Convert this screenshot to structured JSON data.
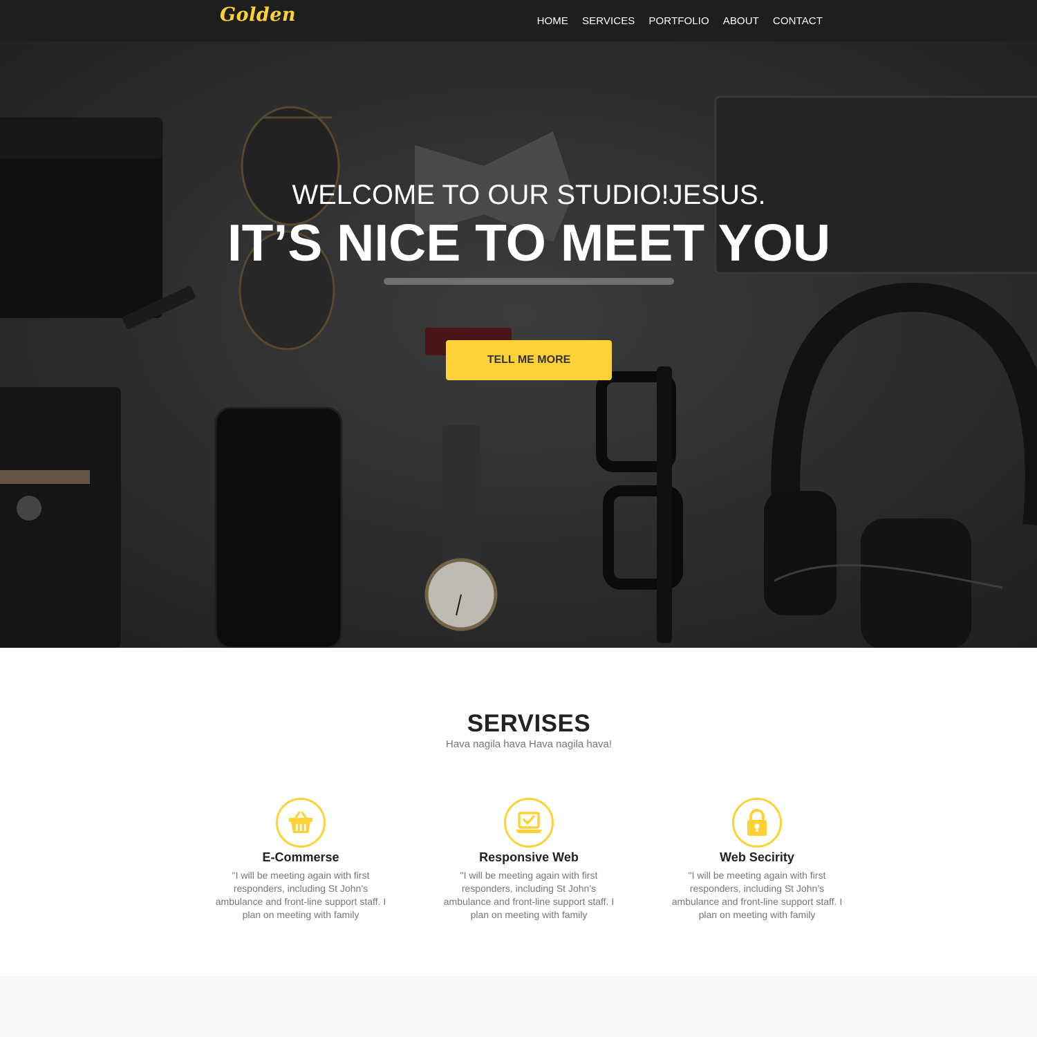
{
  "brand": {
    "logo": "Golden",
    "accent": "#fed136"
  },
  "nav": {
    "items": [
      "HOME",
      "SERVICES",
      "PORTFOLIO",
      "ABOUT",
      "CONTACT"
    ]
  },
  "hero": {
    "subheading": "WELCOME TO OUR STUDIO!JESUS.",
    "heading": "IT’S NICE TO MEET YOU",
    "button": "TELL ME MORE"
  },
  "services": {
    "title": "SERVISES",
    "subtitle": "Hava nagila hava Hava nagila hava!",
    "items": [
      {
        "icon": "shopping-basket-icon",
        "title": "E-Commerse",
        "text": "\"I will be meeting again with first responders, including St John’s ambulance and front-line support staff. I plan on meeting with family"
      },
      {
        "icon": "laptop-check-icon",
        "title": "Responsive Web",
        "text": "\"I will be meeting again with first responders, including St John’s ambulance and front-line support staff. I plan on meeting with family"
      },
      {
        "icon": "lock-icon",
        "title": "Web Secirity",
        "text": "\"I will be meeting again with first responders, including St John’s ambulance and front-line support staff. I plan on meeting with family"
      }
    ]
  }
}
